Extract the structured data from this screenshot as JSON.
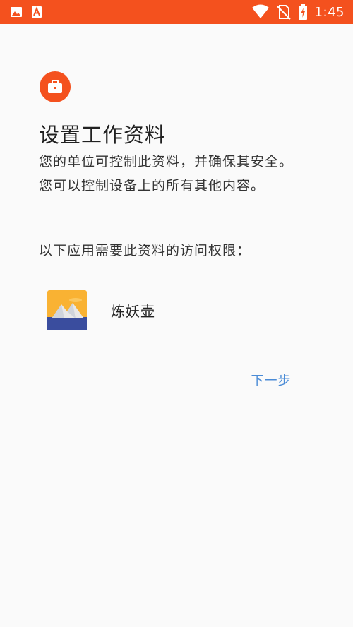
{
  "status_bar": {
    "time": "1:45",
    "background_color": "#f4511e",
    "left_icons": [
      "image-icon",
      "text-a-icon"
    ],
    "right_icons": [
      "wifi-icon",
      "no-sim-icon",
      "battery-charging-icon"
    ]
  },
  "header": {
    "badge_icon": "briefcase-icon",
    "badge_color": "#f4511e",
    "title": "设置工作资料"
  },
  "main": {
    "description": "您的单位可控制此资料，并确保其安全。您可以控制设备上的所有其他内容。",
    "access_label": "以下应用需要此资料的访问权限：",
    "apps": [
      {
        "name": "炼妖壶",
        "icon": "mountain-landscape-icon"
      }
    ]
  },
  "actions": {
    "next_label": "下一步",
    "next_color": "#4a8bd6"
  }
}
